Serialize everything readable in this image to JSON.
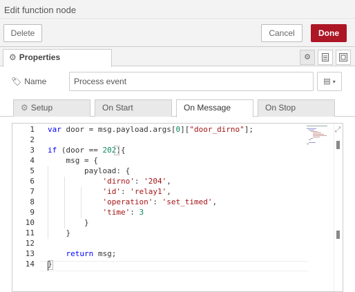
{
  "title": "Edit function node",
  "actions": {
    "delete": "Delete",
    "cancel": "Cancel",
    "done": "Done"
  },
  "tabs": {
    "properties": "Properties"
  },
  "name_field": {
    "label": "Name",
    "value": "Process event"
  },
  "subtabs": [
    "Setup",
    "On Start",
    "On Message",
    "On Stop"
  ],
  "active_subtab": "On Message",
  "editor": {
    "line_numbers": [
      "1",
      "2",
      "3",
      "4",
      "5",
      "6",
      "7",
      "8",
      "9",
      "10",
      "11",
      "12",
      "13",
      "14"
    ],
    "lines": [
      "var door = msg.payload.args[0][\"door_dirno\"];",
      "",
      "if (door == 202){",
      "    msg = {",
      "        payload: {",
      "            'dirno': '204',",
      "            'id': 'relay1',",
      "            'operation': 'set_timed',",
      "            'time': 3",
      "        }",
      "    }",
      "",
      "    return msg;",
      "}"
    ]
  },
  "colors": {
    "done": "#ad1625",
    "keyword": "#0000ff",
    "string": "#a31515",
    "number": "#09885a"
  },
  "icons": [
    "gear-icon",
    "description-icon",
    "appearance-icon",
    "tag-icon",
    "book-icon",
    "chevron-down-icon",
    "expand-icon"
  ]
}
